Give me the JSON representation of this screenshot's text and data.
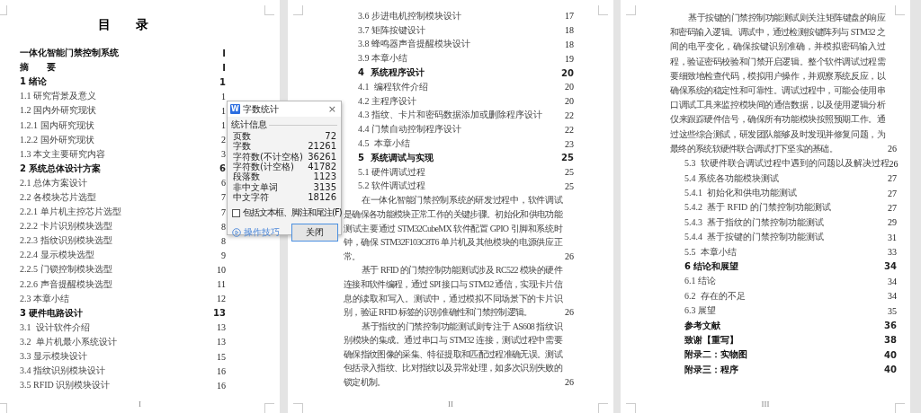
{
  "pages": [
    {
      "heading": "目　　录",
      "footer": "I",
      "blocks": [
        {
          "kind": "entry",
          "text": "一体化智能门禁控制系统",
          "page": "I",
          "bold": true
        },
        {
          "kind": "entry",
          "text": "摘　　要",
          "page": "I",
          "bold": true
        },
        {
          "kind": "entry",
          "text": "1 绪论",
          "page": "1",
          "bold": true
        },
        {
          "kind": "entry",
          "text": "1.1 研究背景及意义",
          "page": "1",
          "bold": false
        },
        {
          "kind": "entry",
          "text": "1.2 国内外研究现状",
          "page": "1",
          "bold": false
        },
        {
          "kind": "entry",
          "text": "1.2.1 国内研究现状",
          "page": "1",
          "bold": false
        },
        {
          "kind": "entry",
          "text": "1.2.2 国外研究现状",
          "page": "2",
          "bold": false
        },
        {
          "kind": "entry",
          "text": "1.3 本文主要研究内容",
          "page": "3",
          "bold": false
        },
        {
          "kind": "entry",
          "text": "2 系统总体设计方案",
          "page": "6",
          "bold": true
        },
        {
          "kind": "entry",
          "text": "2.1 总体方案设计",
          "page": "6",
          "bold": false
        },
        {
          "kind": "entry",
          "text": "2.2 各模块芯片选型",
          "page": "7",
          "bold": false
        },
        {
          "kind": "entry",
          "text": "2.2.1 单片机主控芯片选型",
          "page": "7",
          "bold": false
        },
        {
          "kind": "entry",
          "text": "2.2.2 卡片识别模块选型",
          "page": "8",
          "bold": false
        },
        {
          "kind": "entry",
          "text": "2.2.3 指纹识别模块选型",
          "page": "8",
          "bold": false
        },
        {
          "kind": "entry",
          "text": "2.2.4 显示模块选型",
          "page": "9",
          "bold": false
        },
        {
          "kind": "entry",
          "text": "2.2.5 门锁控制模块选型",
          "page": "10",
          "bold": false
        },
        {
          "kind": "entry",
          "text": "2.2.6 声音提醒模块选型",
          "page": "11",
          "bold": false
        },
        {
          "kind": "entry",
          "text": "2.3 本章小结",
          "page": "12",
          "bold": false
        },
        {
          "kind": "entry",
          "text": "3 硬件电路设计",
          "page": "13",
          "bold": true
        },
        {
          "kind": "entry",
          "text": "3.1  设计软件介绍",
          "page": "13",
          "bold": false
        },
        {
          "kind": "entry",
          "text": "3.2  单片机最小系统设计",
          "page": "13",
          "bold": false
        },
        {
          "kind": "entry",
          "text": "3.3 显示模块设计",
          "page": "15",
          "bold": false
        },
        {
          "kind": "entry",
          "text": "3.4 指纹识别模块设计",
          "page": "16",
          "bold": false
        },
        {
          "kind": "entry",
          "text": "3.5 RFID 识别模块设计",
          "page": "16",
          "bold": false
        }
      ]
    },
    {
      "footer": "II",
      "blocks": [
        {
          "kind": "entry",
          "text": "3.6 步进电机控制模块设计",
          "page": "17",
          "bold": false
        },
        {
          "kind": "entry",
          "text": "3.7 矩阵按键设计",
          "page": "18",
          "bold": false
        },
        {
          "kind": "entry",
          "text": "3.8 蜂鸣器声音提醒模块设计",
          "page": "18",
          "bold": false
        },
        {
          "kind": "entry",
          "text": "3.9 本章小结",
          "page": "19",
          "bold": false
        },
        {
          "kind": "entry",
          "text": "4  系统程序设计",
          "page": "20",
          "bold": true
        },
        {
          "kind": "entry",
          "text": "4.1  编程软件介绍",
          "page": "20",
          "bold": false
        },
        {
          "kind": "entry",
          "text": "4.2 主程序设计",
          "page": "20",
          "bold": false
        },
        {
          "kind": "entry",
          "text": "4.3 指纹、卡片和密码数据添加或删除程序设计",
          "page": "22",
          "bold": false
        },
        {
          "kind": "entry",
          "text": "4.4 门禁自动控制程序设计",
          "page": "22",
          "bold": false
        },
        {
          "kind": "entry",
          "text": "4.5  本章小结",
          "page": "23",
          "bold": false
        },
        {
          "kind": "entry",
          "text": "5  系统调试与实现",
          "page": "25",
          "bold": true
        },
        {
          "kind": "entry",
          "text": "5.1 硬件调试过程",
          "page": "25",
          "bold": false
        },
        {
          "kind": "entry",
          "text": "5.2 软件调试过程",
          "page": "25",
          "bold": false
        },
        {
          "kind": "paragraph",
          "text": "在一体化智能门禁控制系统的研发过程中，软件调试是确保各功能模块正常工作的关键步骤。初始化和供电功能测试主要通过 STM32CubeMX 软件配置 GPIO 引脚和系统时钟，确保 STM32F103C8T6 单片机及其他模块的电源供应正常。",
          "page": "26"
        },
        {
          "kind": "paragraph",
          "text": "基于 RFID 的门禁控制功能测试涉及 RC522 模块的硬件连接和软件编程，通过 SPI 接口与 STM32 通信，实现卡片信息的读取和写入。测试中，通过模拟不同场景下的卡片识别，验证 RFID 标签的识别准确性和门禁控制逻辑。",
          "page": "26"
        },
        {
          "kind": "paragraph",
          "text": "基于指纹的门禁控制功能测试则专注于 AS608 指纹识别模块的集成。通过串口与 STM32 连接，测试过程中需要确保指纹图像的采集、特征提取和匹配过程准确无误。测试包括录入指纹、比对指纹以及异常处理，如多次识别失败的锁定机制。",
          "page": "26"
        }
      ]
    },
    {
      "footer": "III",
      "blocks": [
        {
          "kind": "paragraph",
          "text": "基于按键的门禁控制功能测试则关注矩阵键盘的响应和密码输入逻辑。调试中，通过检测按键阵列与 STM32 之间的电平变化，确保按键识别准确，并模拟密码输入过程，验证密码校验和门禁开启逻辑。整个软件调试过程需要细致地检查代码，模拟用户操作，并观察系统反应，以确保系统的稳定性和可靠性。调试过程中，可能会使用串口调试工具来监控模块间的通信数据，以及使用逻辑分析仪来跟踪硬件信号，确保所有功能模块按照预期工作。通过这些综合测试，研发团队能够及时发现并修复问题，为最终的系统软硬件联合调试打下坚实的基础。",
          "page": "26"
        },
        {
          "kind": "entry",
          "text": "5.3  软硬件联合调试过程中遇到的问题以及解决过程",
          "page": "26",
          "bold": false
        },
        {
          "kind": "entry",
          "text": "5.4 系统各功能模块测试",
          "page": "27",
          "bold": false
        },
        {
          "kind": "entry",
          "text": "5.4.1  初始化和供电功能测试",
          "page": "27",
          "bold": false
        },
        {
          "kind": "entry",
          "text": "5.4.2  基于 RFID 的门禁控制功能测试",
          "page": "27",
          "bold": false
        },
        {
          "kind": "entry",
          "text": "5.4.3  基于指纹的门禁控制功能测试",
          "page": "29",
          "bold": false
        },
        {
          "kind": "entry",
          "text": "5.4.4  基于按键的门禁控制功能测试",
          "page": "31",
          "bold": false
        },
        {
          "kind": "entry",
          "text": "5.5  本章小结",
          "page": "33",
          "bold": false
        },
        {
          "kind": "entry",
          "text": "6 结论和展望",
          "page": "34",
          "bold": true
        },
        {
          "kind": "entry",
          "text": "6.1 结论",
          "page": "34",
          "bold": false
        },
        {
          "kind": "entry",
          "text": "6.2  存在的不足",
          "page": "34",
          "bold": false
        },
        {
          "kind": "entry",
          "text": "6.3 展望",
          "page": "35",
          "bold": false
        },
        {
          "kind": "entry",
          "text": "参考文献",
          "page": "36",
          "bold": true
        },
        {
          "kind": "entry",
          "text": "致谢【重写】",
          "page": "38",
          "bold": true
        },
        {
          "kind": "entry",
          "text": "附录二：实物图",
          "page": "40",
          "bold": true
        },
        {
          "kind": "entry",
          "text": "附录三：程序",
          "page": "40",
          "bold": true
        }
      ]
    }
  ],
  "dialog": {
    "app_icon": "W",
    "title": "字数统计",
    "close": "×",
    "group_label": "统计信息",
    "stats": [
      {
        "label": "页数",
        "value": "72"
      },
      {
        "label": "字数",
        "value": "21261"
      },
      {
        "label": "字符数(不计空格)",
        "value": "36261"
      },
      {
        "label": "字符数(计空格)",
        "value": "41782"
      },
      {
        "label": "段落数",
        "value": "1123"
      },
      {
        "label": "非中文单词",
        "value": "3135"
      },
      {
        "label": "中文字符",
        "value": "18126"
      }
    ],
    "checkbox": {
      "label": "包括文本框、脚注和尾注(F)",
      "checked": false
    },
    "tips_link": "操作技巧",
    "button": "关闭"
  }
}
